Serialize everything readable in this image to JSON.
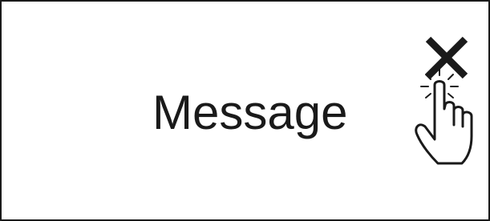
{
  "dialog": {
    "message": "Message"
  },
  "icons": {
    "close": "close-icon",
    "pointer": "tap-hand-icon"
  },
  "colors": {
    "stroke": "#1a1a1a",
    "background": "#ffffff"
  }
}
